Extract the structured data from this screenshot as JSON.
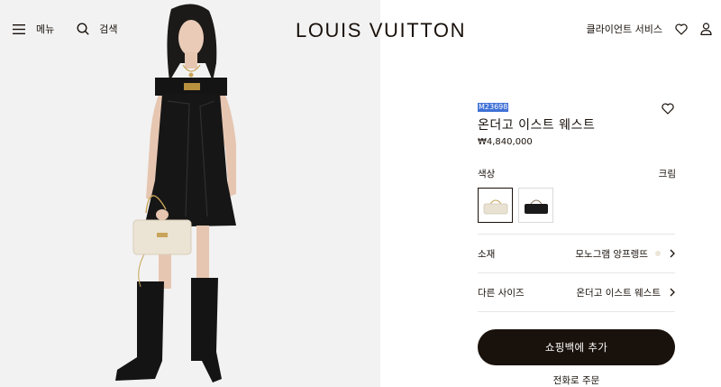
{
  "header": {
    "menu_label": "메뉴",
    "search_label": "검색",
    "logo": "LOUIS VUITTON",
    "client_service": "클라이언트 서비스",
    "icons": [
      "hamburger-icon",
      "search-icon",
      "heart-icon",
      "user-icon"
    ]
  },
  "product": {
    "sku": "M23698",
    "name": "온더고 이스트 웨스트",
    "price": "₩4,840,000",
    "color_label": "색상",
    "color_value": "크림",
    "swatches": [
      {
        "name": "cream",
        "color": "#e9e2d3",
        "selected": true
      },
      {
        "name": "black",
        "color": "#1a1a1a",
        "selected": false
      }
    ],
    "material_label": "소재",
    "material_value": "모노그램 앙프렝뜨",
    "material_dot_color": "#ece6d8",
    "size_label": "다른 사이즈",
    "size_value": "온더고 이스트 웨스트",
    "add_to_cart": "쇼핑백에 추가",
    "phone_order": "전화로 주문"
  },
  "colors": {
    "text": "#19110b",
    "button_bg": "#19110b",
    "sku_highlight": "#3f71d6",
    "divider": "#e6e6e6",
    "image_bg": "#f2f2f2"
  }
}
